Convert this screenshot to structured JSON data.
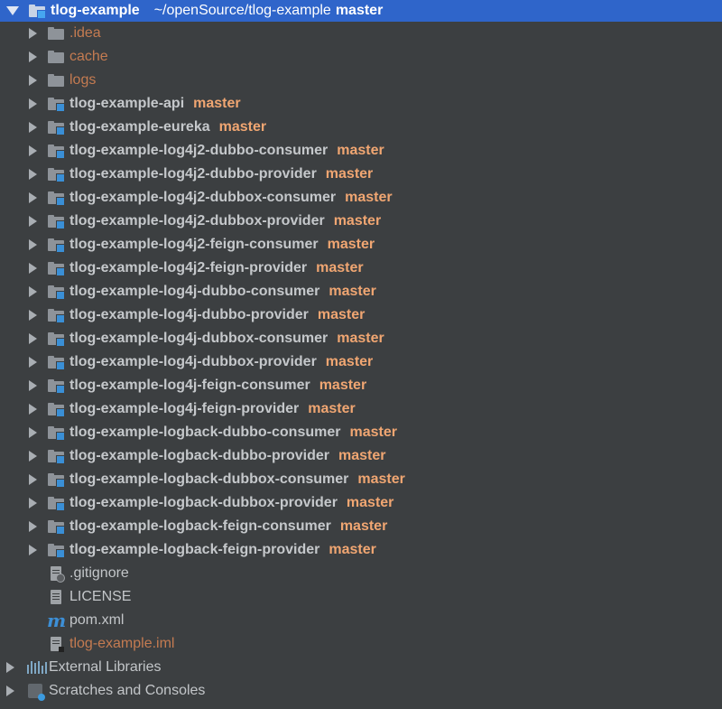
{
  "root": {
    "name": "tlog-example",
    "path": "~/openSource/tlog-example",
    "branch": "master"
  },
  "folders": [
    {
      "name": ".idea",
      "style": "excluded"
    },
    {
      "name": "cache",
      "style": "excluded"
    },
    {
      "name": "logs",
      "style": "excluded"
    }
  ],
  "modules": [
    {
      "name": "tlog-example-api",
      "branch": "master"
    },
    {
      "name": "tlog-example-eureka",
      "branch": "master"
    },
    {
      "name": "tlog-example-log4j2-dubbo-consumer",
      "branch": "master"
    },
    {
      "name": "tlog-example-log4j2-dubbo-provider",
      "branch": "master"
    },
    {
      "name": "tlog-example-log4j2-dubbox-consumer",
      "branch": "master"
    },
    {
      "name": "tlog-example-log4j2-dubbox-provider",
      "branch": "master"
    },
    {
      "name": "tlog-example-log4j2-feign-consumer",
      "branch": "master"
    },
    {
      "name": "tlog-example-log4j2-feign-provider",
      "branch": "master"
    },
    {
      "name": "tlog-example-log4j-dubbo-consumer",
      "branch": "master"
    },
    {
      "name": "tlog-example-log4j-dubbo-provider",
      "branch": "master"
    },
    {
      "name": "tlog-example-log4j-dubbox-consumer",
      "branch": "master"
    },
    {
      "name": "tlog-example-log4j-dubbox-provider",
      "branch": "master"
    },
    {
      "name": "tlog-example-log4j-feign-consumer",
      "branch": "master"
    },
    {
      "name": "tlog-example-log4j-feign-provider",
      "branch": "master"
    },
    {
      "name": "tlog-example-logback-dubbo-consumer",
      "branch": "master"
    },
    {
      "name": "tlog-example-logback-dubbo-provider",
      "branch": "master"
    },
    {
      "name": "tlog-example-logback-dubbox-consumer",
      "branch": "master"
    },
    {
      "name": "tlog-example-logback-dubbox-provider",
      "branch": "master"
    },
    {
      "name": "tlog-example-logback-feign-consumer",
      "branch": "master"
    },
    {
      "name": "tlog-example-logback-feign-provider",
      "branch": "master"
    }
  ],
  "files": [
    {
      "name": ".gitignore",
      "icon": "gitignore-file-icon"
    },
    {
      "name": "LICENSE",
      "icon": "text-file-icon"
    },
    {
      "name": "pom.xml",
      "icon": "maven-icon",
      "icon_glyph": "m"
    },
    {
      "name": "tlog-example.iml",
      "icon": "iml-file-icon",
      "style": "excluded"
    }
  ],
  "top_level": [
    {
      "name": "External Libraries",
      "icon": "libraries-icon"
    },
    {
      "name": "Scratches and Consoles",
      "icon": "scratches-icon"
    }
  ],
  "colors": {
    "background": "#3c3f41",
    "selection": "#2f65ca",
    "branch": "#f0a672",
    "excluded": "#c47b51",
    "module_badge": "#3a8fd6"
  }
}
